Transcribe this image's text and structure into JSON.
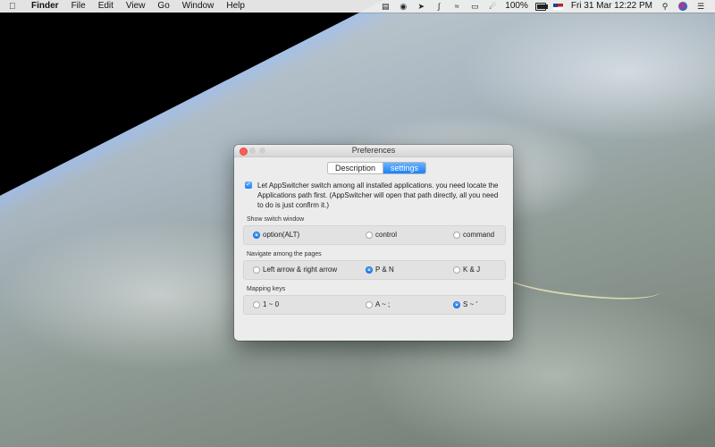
{
  "menubar": {
    "apple_icon": "apple-logo-icon",
    "items": [
      "Finder",
      "File",
      "Edit",
      "View",
      "Go",
      "Window",
      "Help"
    ],
    "battery_percent": "100%",
    "clock": "Fri 31 Mar  12:22 PM"
  },
  "window": {
    "title": "Preferences",
    "tabs": [
      {
        "label": "Description",
        "active": false
      },
      {
        "label": "settings",
        "active": true
      }
    ],
    "checkbox": {
      "checked": true,
      "text": "Let AppSwitcher switch among all installed applications. you need locate the Applications path first. (AppSwitcher will open that path directly, all you need to do is just confirm it.)"
    },
    "sections": [
      {
        "label": "Show switch window",
        "options": [
          {
            "label": "option(ALT)",
            "selected": true
          },
          {
            "label": "control",
            "selected": false
          },
          {
            "label": "command",
            "selected": false
          }
        ]
      },
      {
        "label": "Navigate among the pages",
        "options": [
          {
            "label": "Left arrow & right arrow",
            "selected": false
          },
          {
            "label": "P & N",
            "selected": true
          },
          {
            "label": "K & J",
            "selected": false
          }
        ]
      },
      {
        "label": "Mapping keys",
        "options": [
          {
            "label": "1 ~ 0",
            "selected": false
          },
          {
            "label": "A ~ ;",
            "selected": false
          },
          {
            "label": "S ~ '",
            "selected": true
          }
        ]
      }
    ]
  },
  "colors": {
    "accent": "#1a82fb",
    "close_button": "#fc605c"
  }
}
